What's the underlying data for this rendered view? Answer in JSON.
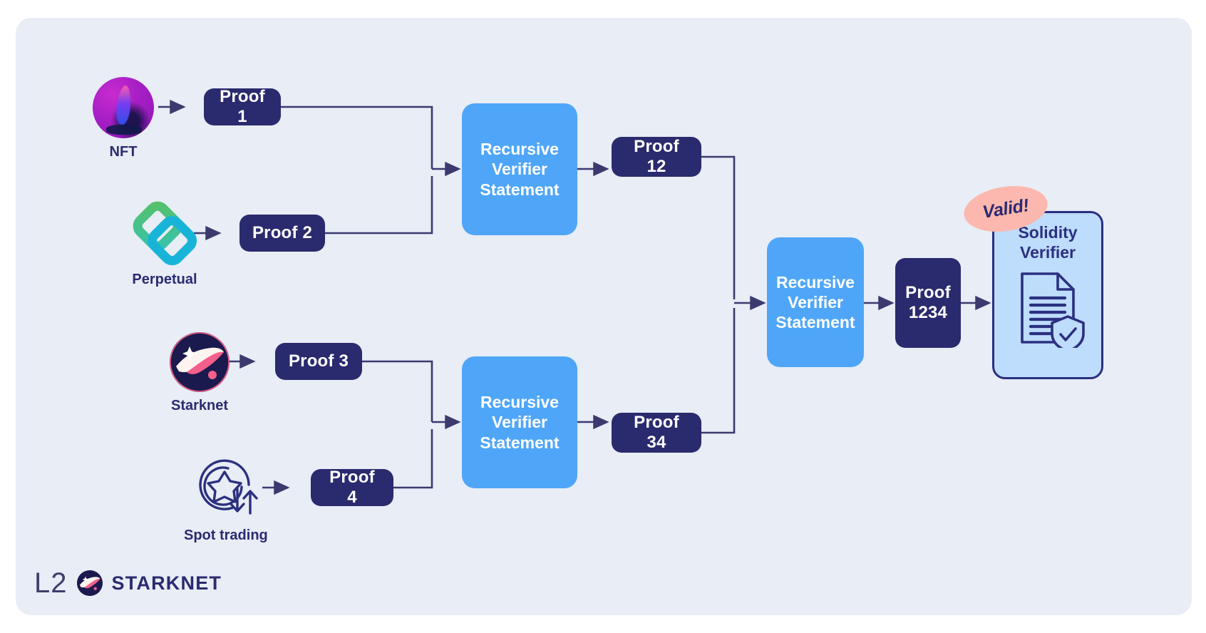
{
  "card": {
    "background_color": "#e8edf6",
    "page_background": "#ffffff"
  },
  "palette": {
    "proof_navy": "#2a2a6e",
    "recursive_blue": "#4fa6f8",
    "verifier_fill": "#bedcfb",
    "verifier_border": "#2b3080",
    "valid_pink": "#fcb8ae",
    "connector": "#3a3a6e",
    "label_navy": "#2b2b70"
  },
  "sources": [
    {
      "id": "nft",
      "label": "NFT",
      "icon": "nft-icon"
    },
    {
      "id": "perpetual",
      "label": "Perpetual",
      "icon": "perpetual-icon"
    },
    {
      "id": "starknet",
      "label": "Starknet",
      "icon": "starknet-icon"
    },
    {
      "id": "spot-trading",
      "label": "Spot trading",
      "icon": "spot-trading-icon"
    }
  ],
  "proofs": {
    "p1": "Proof 1",
    "p2": "Proof 2",
    "p3": "Proof 3",
    "p4": "Proof 4",
    "p12": "Proof 12",
    "p34": "Proof 34",
    "p1234_line1": "Proof",
    "p1234_line2": "1234"
  },
  "recursive": {
    "line1": "Recursive",
    "line2": "Verifier",
    "line3": "Statement"
  },
  "verifier": {
    "title_line1": "Solidity",
    "title_line2": "Verifier",
    "icon": "document-shield-check-icon"
  },
  "badge": {
    "text": "Valid!"
  },
  "footer": {
    "layer": "L2",
    "wordmark": "STARKNET",
    "logo": "starknet-logo-icon"
  }
}
